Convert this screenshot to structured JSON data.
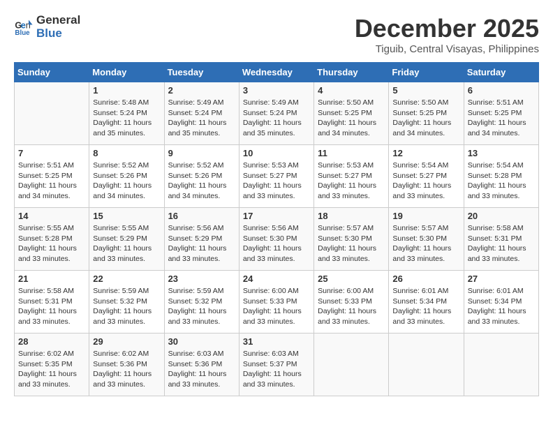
{
  "logo": {
    "line1": "General",
    "line2": "Blue"
  },
  "title": "December 2025",
  "subtitle": "Tiguib, Central Visayas, Philippines",
  "weekdays": [
    "Sunday",
    "Monday",
    "Tuesday",
    "Wednesday",
    "Thursday",
    "Friday",
    "Saturday"
  ],
  "weeks": [
    [
      {
        "day": "",
        "sunrise": "",
        "sunset": "",
        "daylight": ""
      },
      {
        "day": "1",
        "sunrise": "Sunrise: 5:48 AM",
        "sunset": "Sunset: 5:24 PM",
        "daylight": "Daylight: 11 hours and 35 minutes."
      },
      {
        "day": "2",
        "sunrise": "Sunrise: 5:49 AM",
        "sunset": "Sunset: 5:24 PM",
        "daylight": "Daylight: 11 hours and 35 minutes."
      },
      {
        "day": "3",
        "sunrise": "Sunrise: 5:49 AM",
        "sunset": "Sunset: 5:24 PM",
        "daylight": "Daylight: 11 hours and 35 minutes."
      },
      {
        "day": "4",
        "sunrise": "Sunrise: 5:50 AM",
        "sunset": "Sunset: 5:25 PM",
        "daylight": "Daylight: 11 hours and 34 minutes."
      },
      {
        "day": "5",
        "sunrise": "Sunrise: 5:50 AM",
        "sunset": "Sunset: 5:25 PM",
        "daylight": "Daylight: 11 hours and 34 minutes."
      },
      {
        "day": "6",
        "sunrise": "Sunrise: 5:51 AM",
        "sunset": "Sunset: 5:25 PM",
        "daylight": "Daylight: 11 hours and 34 minutes."
      }
    ],
    [
      {
        "day": "7",
        "sunrise": "Sunrise: 5:51 AM",
        "sunset": "Sunset: 5:25 PM",
        "daylight": "Daylight: 11 hours and 34 minutes."
      },
      {
        "day": "8",
        "sunrise": "Sunrise: 5:52 AM",
        "sunset": "Sunset: 5:26 PM",
        "daylight": "Daylight: 11 hours and 34 minutes."
      },
      {
        "day": "9",
        "sunrise": "Sunrise: 5:52 AM",
        "sunset": "Sunset: 5:26 PM",
        "daylight": "Daylight: 11 hours and 34 minutes."
      },
      {
        "day": "10",
        "sunrise": "Sunrise: 5:53 AM",
        "sunset": "Sunset: 5:27 PM",
        "daylight": "Daylight: 11 hours and 33 minutes."
      },
      {
        "day": "11",
        "sunrise": "Sunrise: 5:53 AM",
        "sunset": "Sunset: 5:27 PM",
        "daylight": "Daylight: 11 hours and 33 minutes."
      },
      {
        "day": "12",
        "sunrise": "Sunrise: 5:54 AM",
        "sunset": "Sunset: 5:27 PM",
        "daylight": "Daylight: 11 hours and 33 minutes."
      },
      {
        "day": "13",
        "sunrise": "Sunrise: 5:54 AM",
        "sunset": "Sunset: 5:28 PM",
        "daylight": "Daylight: 11 hours and 33 minutes."
      }
    ],
    [
      {
        "day": "14",
        "sunrise": "Sunrise: 5:55 AM",
        "sunset": "Sunset: 5:28 PM",
        "daylight": "Daylight: 11 hours and 33 minutes."
      },
      {
        "day": "15",
        "sunrise": "Sunrise: 5:55 AM",
        "sunset": "Sunset: 5:29 PM",
        "daylight": "Daylight: 11 hours and 33 minutes."
      },
      {
        "day": "16",
        "sunrise": "Sunrise: 5:56 AM",
        "sunset": "Sunset: 5:29 PM",
        "daylight": "Daylight: 11 hours and 33 minutes."
      },
      {
        "day": "17",
        "sunrise": "Sunrise: 5:56 AM",
        "sunset": "Sunset: 5:30 PM",
        "daylight": "Daylight: 11 hours and 33 minutes."
      },
      {
        "day": "18",
        "sunrise": "Sunrise: 5:57 AM",
        "sunset": "Sunset: 5:30 PM",
        "daylight": "Daylight: 11 hours and 33 minutes."
      },
      {
        "day": "19",
        "sunrise": "Sunrise: 5:57 AM",
        "sunset": "Sunset: 5:30 PM",
        "daylight": "Daylight: 11 hours and 33 minutes."
      },
      {
        "day": "20",
        "sunrise": "Sunrise: 5:58 AM",
        "sunset": "Sunset: 5:31 PM",
        "daylight": "Daylight: 11 hours and 33 minutes."
      }
    ],
    [
      {
        "day": "21",
        "sunrise": "Sunrise: 5:58 AM",
        "sunset": "Sunset: 5:31 PM",
        "daylight": "Daylight: 11 hours and 33 minutes."
      },
      {
        "day": "22",
        "sunrise": "Sunrise: 5:59 AM",
        "sunset": "Sunset: 5:32 PM",
        "daylight": "Daylight: 11 hours and 33 minutes."
      },
      {
        "day": "23",
        "sunrise": "Sunrise: 5:59 AM",
        "sunset": "Sunset: 5:32 PM",
        "daylight": "Daylight: 11 hours and 33 minutes."
      },
      {
        "day": "24",
        "sunrise": "Sunrise: 6:00 AM",
        "sunset": "Sunset: 5:33 PM",
        "daylight": "Daylight: 11 hours and 33 minutes."
      },
      {
        "day": "25",
        "sunrise": "Sunrise: 6:00 AM",
        "sunset": "Sunset: 5:33 PM",
        "daylight": "Daylight: 11 hours and 33 minutes."
      },
      {
        "day": "26",
        "sunrise": "Sunrise: 6:01 AM",
        "sunset": "Sunset: 5:34 PM",
        "daylight": "Daylight: 11 hours and 33 minutes."
      },
      {
        "day": "27",
        "sunrise": "Sunrise: 6:01 AM",
        "sunset": "Sunset: 5:34 PM",
        "daylight": "Daylight: 11 hours and 33 minutes."
      }
    ],
    [
      {
        "day": "28",
        "sunrise": "Sunrise: 6:02 AM",
        "sunset": "Sunset: 5:35 PM",
        "daylight": "Daylight: 11 hours and 33 minutes."
      },
      {
        "day": "29",
        "sunrise": "Sunrise: 6:02 AM",
        "sunset": "Sunset: 5:36 PM",
        "daylight": "Daylight: 11 hours and 33 minutes."
      },
      {
        "day": "30",
        "sunrise": "Sunrise: 6:03 AM",
        "sunset": "Sunset: 5:36 PM",
        "daylight": "Daylight: 11 hours and 33 minutes."
      },
      {
        "day": "31",
        "sunrise": "Sunrise: 6:03 AM",
        "sunset": "Sunset: 5:37 PM",
        "daylight": "Daylight: 11 hours and 33 minutes."
      },
      {
        "day": "",
        "sunrise": "",
        "sunset": "",
        "daylight": ""
      },
      {
        "day": "",
        "sunrise": "",
        "sunset": "",
        "daylight": ""
      },
      {
        "day": "",
        "sunrise": "",
        "sunset": "",
        "daylight": ""
      }
    ]
  ]
}
